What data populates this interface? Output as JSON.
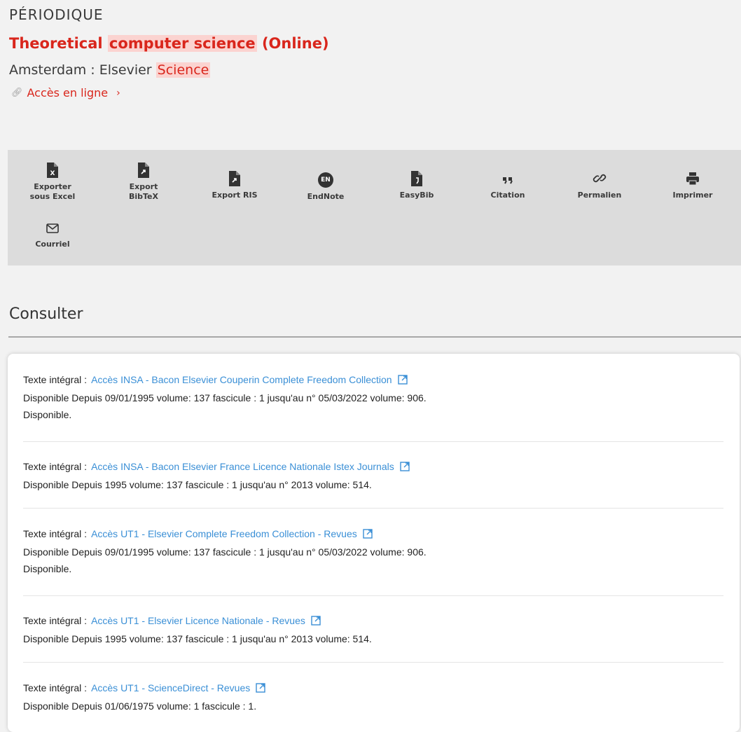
{
  "header": {
    "doc_type": "PÉRIODIQUE",
    "title_before": "Theoretical",
    "title_highlight": "computer science",
    "title_after": "(Online)",
    "publisher_text": "Amsterdam : Elsevier",
    "publisher_highlight": "Science",
    "online_access": "Accès en ligne",
    "accent_color": "#d9261c",
    "highlight_color": "#fbd3d0"
  },
  "toolbar": {
    "excel_1": "Exporter",
    "excel_2": "sous Excel",
    "bibtex_1": "Export",
    "bibtex_2": "BibTeX",
    "ris": "Export RIS",
    "endnote_badge": "EN",
    "endnote": "EndNote",
    "easybib": "EasyBib",
    "citation": "Citation",
    "permalien": "Permalien",
    "imprimer": "Imprimer",
    "courriel": "Courriel"
  },
  "consult": {
    "title": "Consulter",
    "link_color": "#3a8fd6",
    "entries": [
      {
        "label": "Texte intégral :",
        "link": "Accès INSA - Bacon Elsevier Couperin Complete Freedom Collection",
        "line1": "Disponible Depuis 09/01/1995 volume: 137 fascicule : 1 jusqu'au n° 05/03/2022 volume: 906.",
        "line2": "Disponible."
      },
      {
        "label": "Texte intégral :",
        "link": "Accès INSA - Bacon Elsevier France Licence Nationale Istex Journals",
        "line1": "Disponible Depuis 1995 volume: 137 fascicule : 1 jusqu'au n° 2013 volume: 514."
      },
      {
        "label": "Texte intégral :",
        "link": "Accès UT1 - Elsevier Complete Freedom Collection - Revues",
        "line1": "Disponible Depuis 09/01/1995 volume: 137 fascicule : 1 jusqu'au n° 05/03/2022 volume: 906.",
        "line2": "Disponible."
      },
      {
        "label": "Texte intégral :",
        "link": "Accès UT1 - Elsevier Licence Nationale - Revues",
        "line1": "Disponible Depuis 1995 volume: 137 fascicule : 1 jusqu'au n° 2013 volume: 514."
      },
      {
        "label": "Texte intégral :",
        "link": "Accès UT1 - ScienceDirect - Revues",
        "line1": "Disponible Depuis 01/06/1975 volume: 1 fascicule : 1."
      }
    ]
  }
}
